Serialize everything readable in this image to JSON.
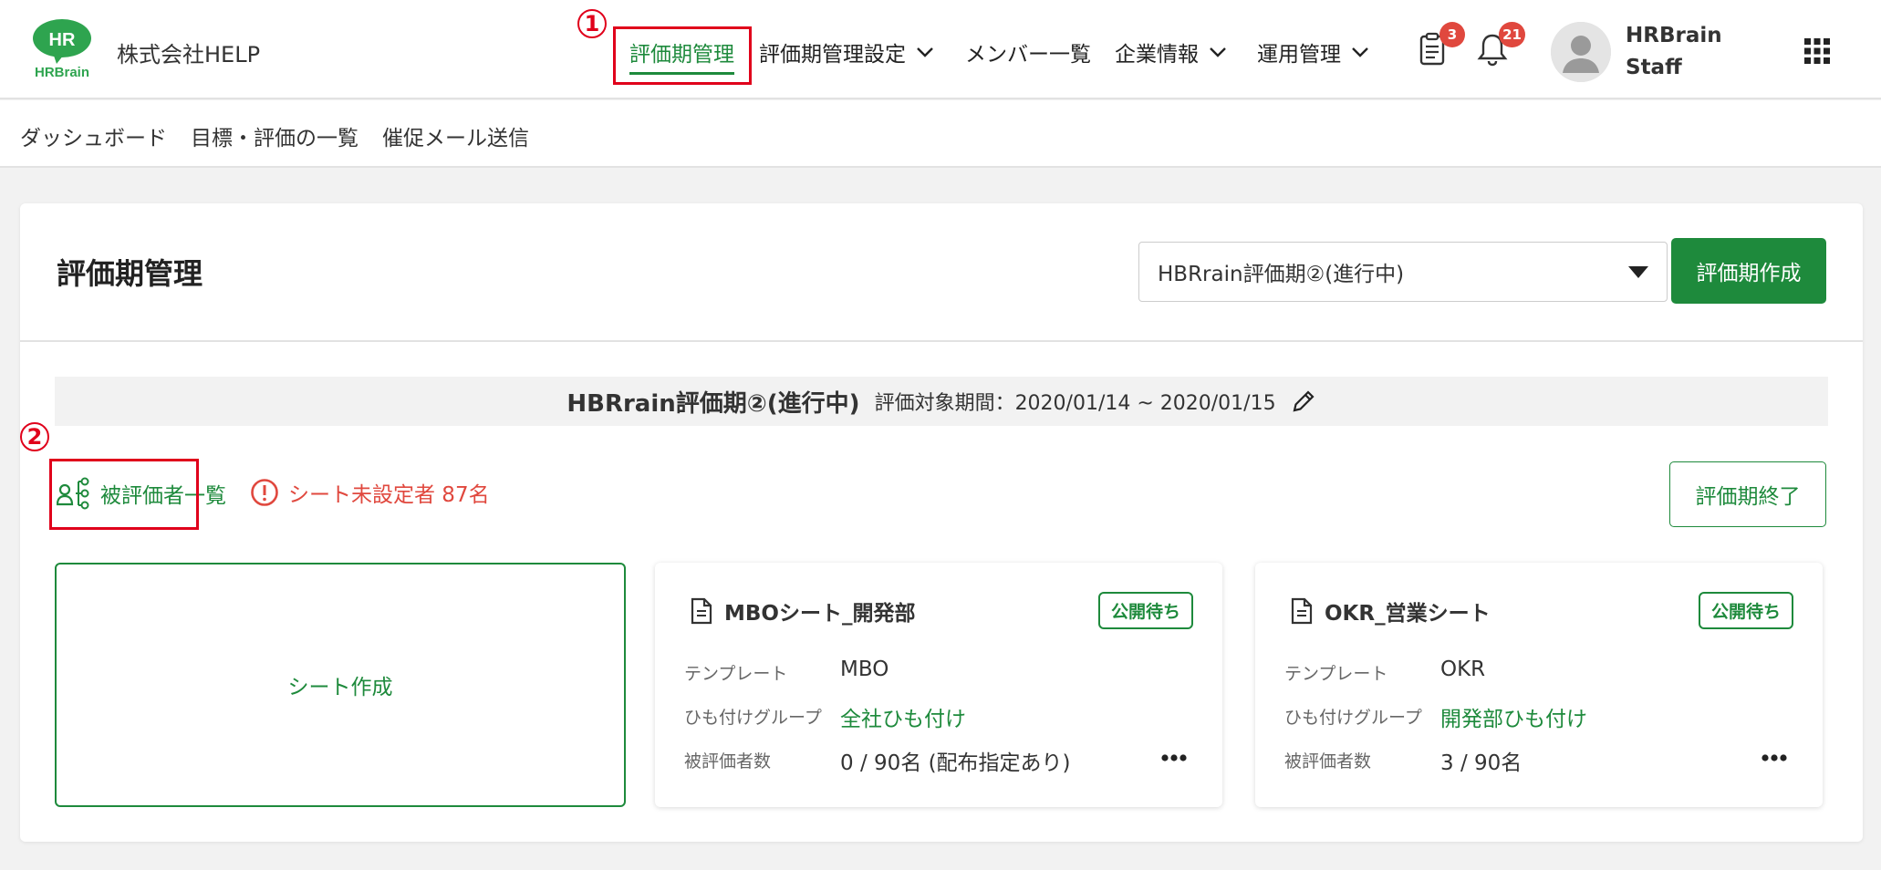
{
  "header": {
    "company": "株式会社HELP",
    "logo_text_top": "HR",
    "logo_text_bottom": "HRBrain",
    "nav": {
      "evaluation_period": "評価期管理",
      "evaluation_settings": "評価期管理設定",
      "members": "メンバー一覧",
      "company_info": "企業情報",
      "operations": "運用管理"
    },
    "tasks_badge": "3",
    "notifications_badge": "21",
    "user_line1": "HRBrain",
    "user_line2": "Staff"
  },
  "annotations": {
    "one": "1",
    "two": "2"
  },
  "subnav": {
    "dashboard": "ダッシュボード",
    "goals": "目標・評価の一覧",
    "reminder": "催促メール送信"
  },
  "main": {
    "title": "評価期管理",
    "period_select": "HBRrain評価期②(進行中)",
    "create_period": "評価期作成",
    "period_name": "HBRrain評価期②(進行中)",
    "period_range": "評価対象期間：2020/01/14 ~ 2020/01/15",
    "evaluee_list": "被評価者一覧",
    "unassigned_warning": "シート未設定者 87名",
    "end_period": "評価期終了",
    "create_sheet": "シート作成"
  },
  "sheets": [
    {
      "title": "MBOシート_開発部",
      "status": "公開待ち",
      "template_label": "テンプレート",
      "template": "MBO",
      "group_label": "ひも付けグループ",
      "group": "全社ひも付け",
      "count_label": "被評価者数",
      "count": "0 / 90名 (配布指定あり)"
    },
    {
      "title": "OKR_営業シート",
      "status": "公開待ち",
      "template_label": "テンプレート",
      "template": "OKR",
      "group_label": "ひも付けグループ",
      "group": "開発部ひも付け",
      "count_label": "被評価者数",
      "count": "3 / 90名"
    }
  ],
  "colors": {
    "brand_green": "#1e8a3c",
    "alert_red": "#e0483e",
    "annotation_red": "#e0001b"
  }
}
